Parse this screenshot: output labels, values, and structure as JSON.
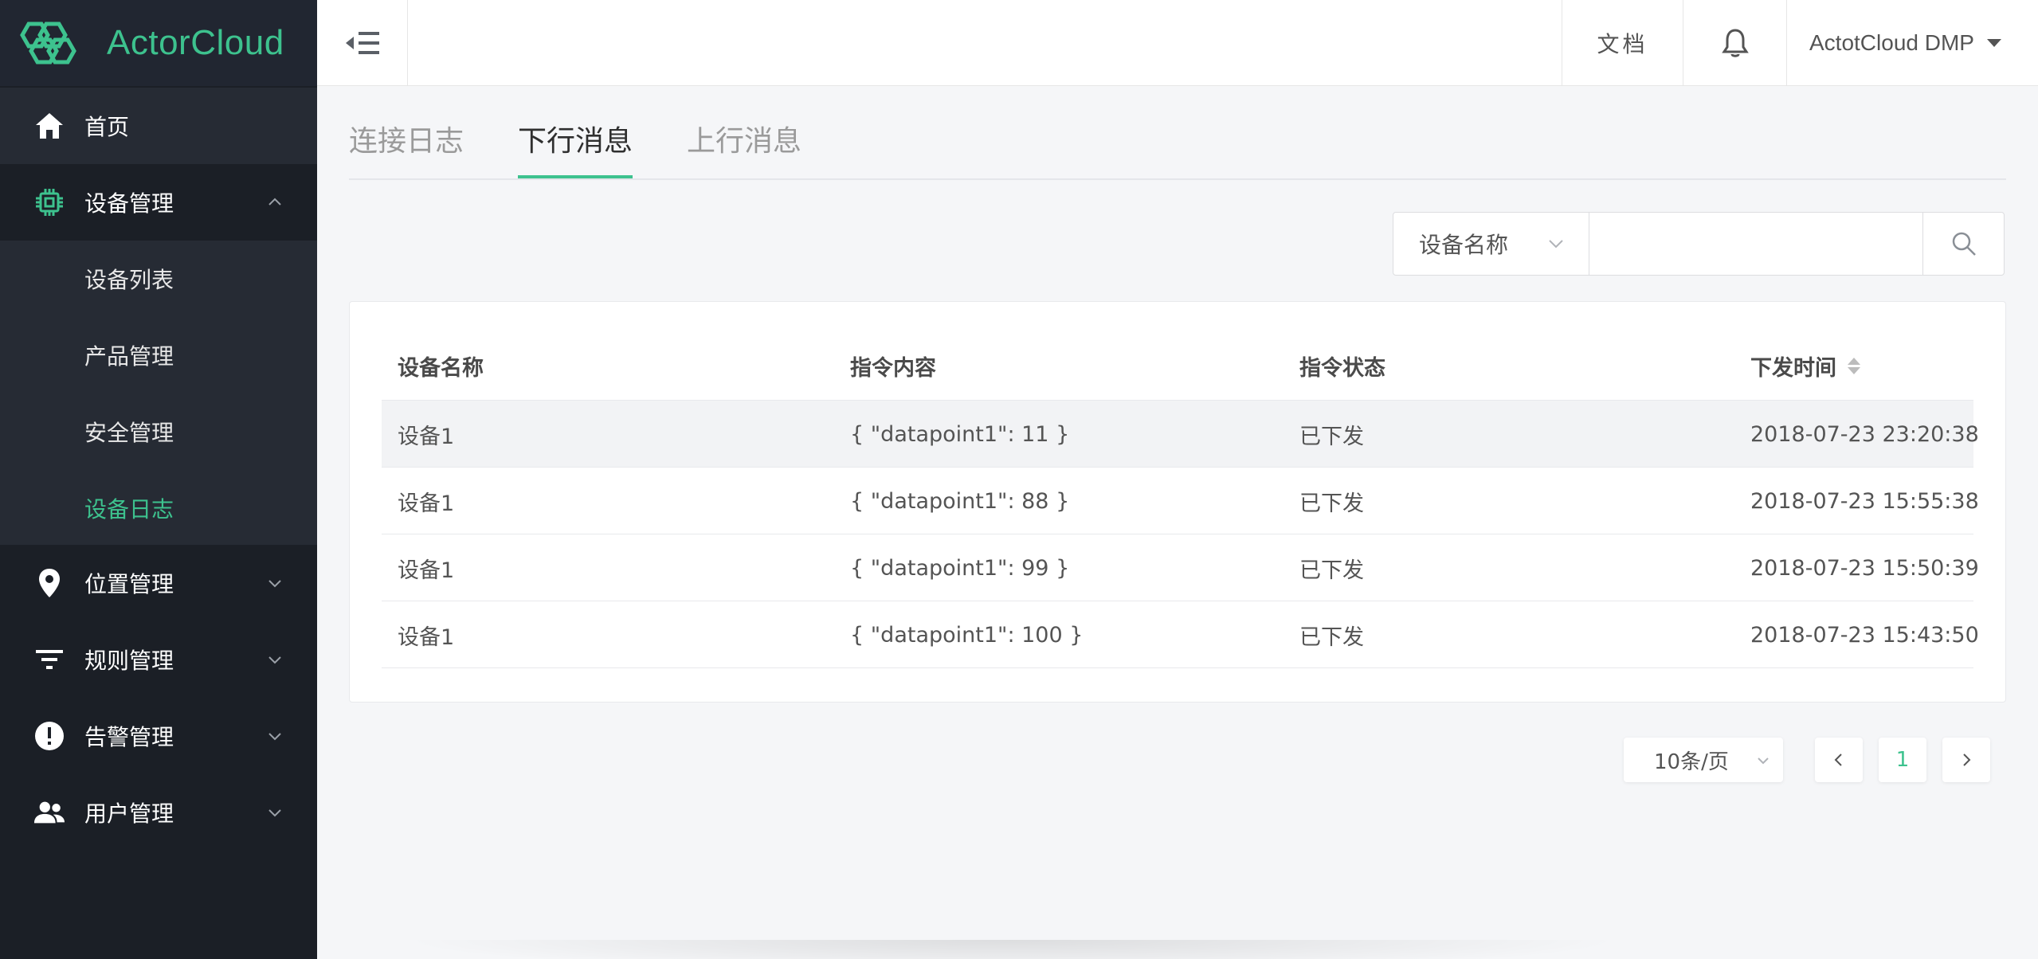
{
  "app": {
    "logo_text": "ActorCloud",
    "accent_color": "#3dc28e",
    "sidebar_bg": "#1b1f26"
  },
  "sidebar": {
    "items": [
      {
        "label": "首页",
        "icon": "home-icon"
      },
      {
        "label": "设备管理",
        "icon": "chip-icon",
        "expanded": true,
        "children": [
          {
            "label": "设备列表"
          },
          {
            "label": "产品管理"
          },
          {
            "label": "安全管理"
          },
          {
            "label": "设备日志",
            "active": true
          }
        ]
      },
      {
        "label": "位置管理",
        "icon": "location-pin-icon"
      },
      {
        "label": "规则管理",
        "icon": "filter-icon"
      },
      {
        "label": "告警管理",
        "icon": "alert-icon"
      },
      {
        "label": "用户管理",
        "icon": "users-icon"
      }
    ]
  },
  "header": {
    "docs_label": "文档",
    "user_label": "ActotCloud DMP"
  },
  "tabs": [
    {
      "label": "连接日志"
    },
    {
      "label": "下行消息",
      "active": true
    },
    {
      "label": "上行消息"
    }
  ],
  "search": {
    "field_selected": "设备名称",
    "value": ""
  },
  "table": {
    "headers": [
      "设备名称",
      "指令内容",
      "指令状态",
      "下发时间"
    ],
    "rows": [
      [
        "设备1",
        "{ \"datapoint1\": 11 }",
        "已下发",
        "2018-07-23 23:20:38"
      ],
      [
        "设备1",
        "{ \"datapoint1\": 88 }",
        "已下发",
        "2018-07-23 15:55:38"
      ],
      [
        "设备1",
        "{ \"datapoint1\": 99 }",
        "已下发",
        "2018-07-23 15:50:39"
      ],
      [
        "设备1",
        "{ \"datapoint1\": 100 }",
        "已下发",
        "2018-07-23 15:43:50"
      ]
    ]
  },
  "pagination": {
    "page_size": "10条/页",
    "current_page": "1"
  }
}
